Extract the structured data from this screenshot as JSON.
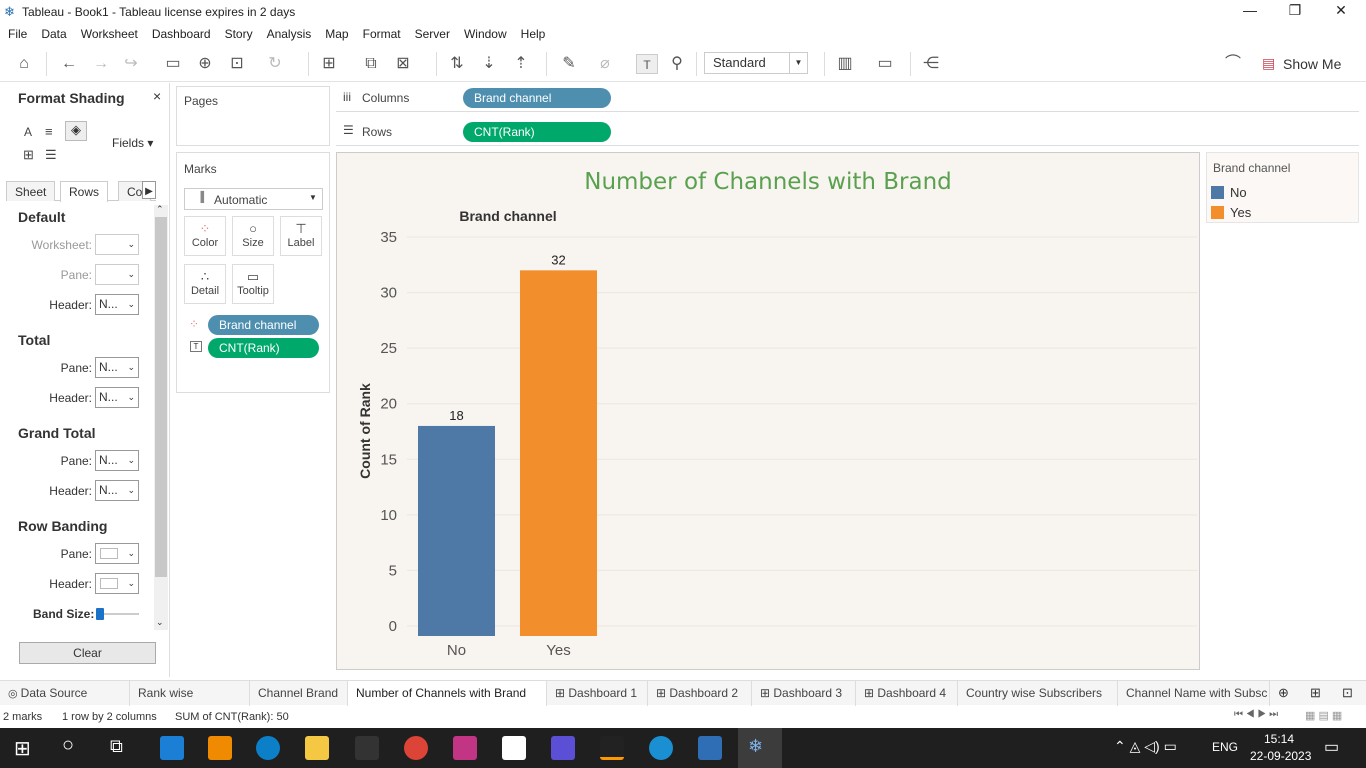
{
  "window": {
    "title": "Tableau - Book1 - Tableau license expires in 2 days",
    "minimize": "—",
    "restore": "❐",
    "close": "✕"
  },
  "menu": [
    "File",
    "Data",
    "Worksheet",
    "Dashboard",
    "Story",
    "Analysis",
    "Map",
    "Format",
    "Server",
    "Window",
    "Help"
  ],
  "toolbar": {
    "fit": "Standard",
    "show_me": "Show Me"
  },
  "format_pane": {
    "title": "Format Shading",
    "close": "×",
    "fields": "Fields ▾",
    "tabs": [
      "Sheet",
      "Rows",
      "Co"
    ],
    "active_tab": "Rows",
    "default": {
      "title": "Default",
      "worksheet": "Worksheet:",
      "pane": "Pane:",
      "header": "Header:",
      "header_value": "N..."
    },
    "total": {
      "title": "Total",
      "pane": "Pane:",
      "pane_value": "N...",
      "header": "Header:",
      "header_value": "N..."
    },
    "grand_total": {
      "title": "Grand Total",
      "pane": "Pane:",
      "pane_value": "N...",
      "header": "Header:",
      "header_value": "N..."
    },
    "row_banding": {
      "title": "Row Banding",
      "pane": "Pane:",
      "header": "Header:",
      "band_size": "Band Size:"
    },
    "clear": "Clear"
  },
  "pages": {
    "label": "Pages"
  },
  "shelves": {
    "columns_label": "Columns",
    "rows_label": "Rows",
    "columns_pill": "Brand channel",
    "rows_pill": "CNT(Rank)"
  },
  "marks": {
    "label": "Marks",
    "type": "Automatic",
    "cards": [
      "Color",
      "Size",
      "Label",
      "Detail",
      "Tooltip"
    ],
    "pills": [
      "Brand channel",
      "CNT(Rank)"
    ]
  },
  "chart_data": {
    "type": "bar",
    "title": "Number of Channels with Brand",
    "header": "Brand channel",
    "ylabel": "Count of Rank",
    "categories": [
      "No",
      "Yes"
    ],
    "values": [
      18,
      32
    ],
    "colors": [
      "#4e79a7",
      "#f28e2b"
    ],
    "ylim": [
      0,
      35
    ],
    "yticks": [
      0,
      5,
      10,
      15,
      20,
      25,
      30,
      35
    ],
    "title_color": "#59a14f"
  },
  "legend": {
    "title": "Brand channel",
    "items": [
      {
        "label": "No",
        "color": "#4e79a7"
      },
      {
        "label": "Yes",
        "color": "#f28e2b"
      }
    ]
  },
  "sheet_tabs": [
    "Data Source",
    "Rank wise Channel",
    "Channel Brand",
    "Number of Channels with Brand",
    "Dashboard 1",
    "Dashboard 2",
    "Dashboard 3",
    "Dashboard 4",
    "Country wise Subscribers",
    "Channel Name with Subsc"
  ],
  "active_sheet": "Number of Channels with Brand",
  "status": {
    "marks": "2 marks",
    "rows_cols": "1 row by 2 columns",
    "sum": "SUM of CNT(Rank): 50"
  },
  "taskbar": {
    "lang": "ENG",
    "time": "15:14",
    "date": "22-09-2023"
  }
}
